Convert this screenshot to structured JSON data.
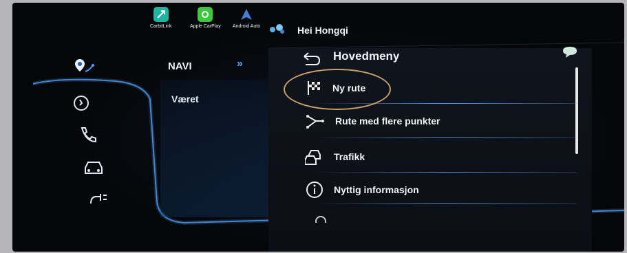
{
  "status_bar": {
    "apps": [
      {
        "name": "CarbitLink",
        "color": "#1fb5a0",
        "icon": "carbitlink-icon"
      },
      {
        "name": "Apple CarPlay",
        "color": "#3ec83e",
        "icon": "carplay-icon"
      },
      {
        "name": "Android Auto",
        "color": "#3f7fd9",
        "icon": "android-auto-icon"
      }
    ],
    "greeting": "Hei Hongqi"
  },
  "sidebar": {
    "items": [
      {
        "icon": "navigation-icon"
      },
      {
        "icon": "music-icon"
      },
      {
        "icon": "phone-icon"
      },
      {
        "icon": "car-icon"
      },
      {
        "icon": "charging-icon"
      }
    ]
  },
  "left_menu": {
    "header": "NAVI",
    "item": "Været"
  },
  "main_menu": {
    "title": "Hovedmeny",
    "items": [
      {
        "label": "Ny rute",
        "icon": "checkered-flag-icon"
      },
      {
        "label": "Rute med flere punkter",
        "icon": "multi-point-route-icon"
      },
      {
        "label": "Trafikk",
        "icon": "traffic-icon"
      },
      {
        "label": "Nyttig informasjon",
        "icon": "info-icon"
      }
    ]
  },
  "colors": {
    "accent": "#4ca2ff",
    "highlight_ring": "#c8a06a"
  }
}
